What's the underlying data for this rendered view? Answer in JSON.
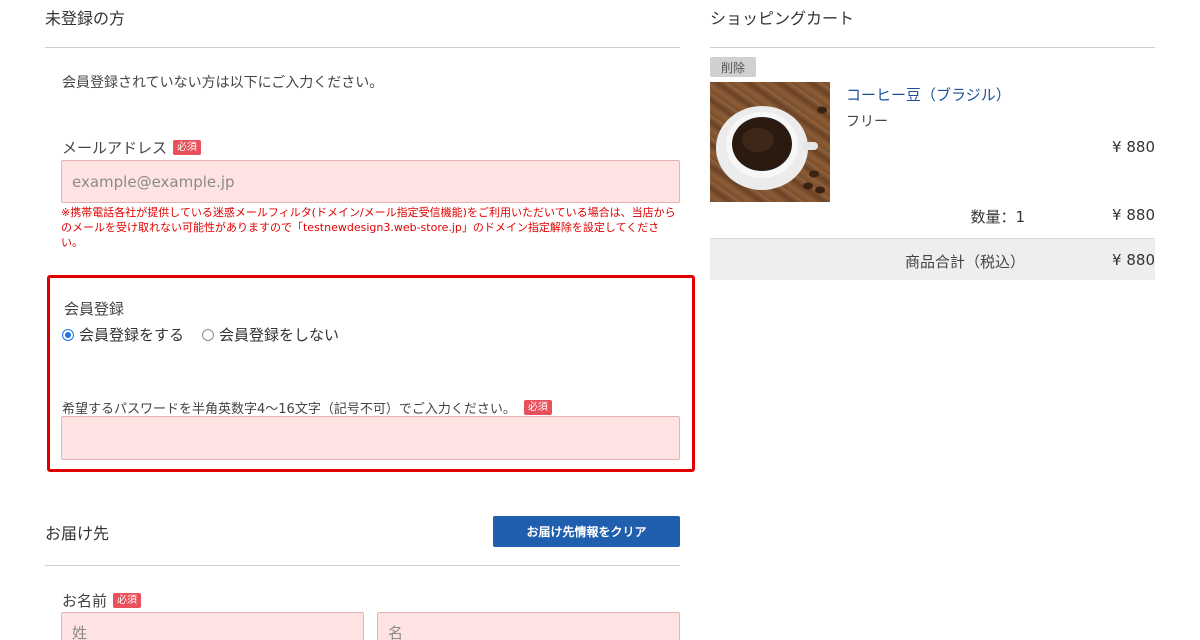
{
  "left": {
    "title": "未登録の方",
    "intro": "会員登録されていない方は以下にご入力ください。",
    "email": {
      "label": "メールアドレス",
      "required": "必須",
      "placeholder": "example@example.jp"
    },
    "warning": "※携帯電話各社が提供している迷惑メールフィルタ(ドメイン/メール指定受信機能)をご利用いただいている場合は、当店からのメールを受け取れない可能性がありますので「testnewdesign3.web-store.jp」のドメイン指定解除を設定してください。",
    "member": {
      "title": "会員登録",
      "options": [
        "会員登録をする",
        "会員登録をしない"
      ],
      "selected": 0,
      "password_label": "希望するパスワードを半角英数字4〜16文字（記号不可）でご入力ください。",
      "required": "必須"
    },
    "shipping": {
      "title": "お届け先",
      "clear_button": "お届け先情報をクリア",
      "name_label": "お名前",
      "required": "必須",
      "last_placeholder": "姓",
      "first_placeholder": "名"
    }
  },
  "cart": {
    "title": "ショッピングカート",
    "delete": "削除",
    "product_name": "コーヒー豆（ブラジル）",
    "variant": "フリー",
    "price": "¥ 880",
    "qty_label": "数量：1",
    "qty_price": "¥ 880",
    "total_label": "商品合計（税込）",
    "total_value": "¥ 880"
  },
  "colors": {
    "required_badge": "#e8505b",
    "input_bg": "#ffe3e3",
    "highlight_border": "#e00000",
    "button_blue": "#1f5fae",
    "product_link": "#1d4f9a"
  }
}
